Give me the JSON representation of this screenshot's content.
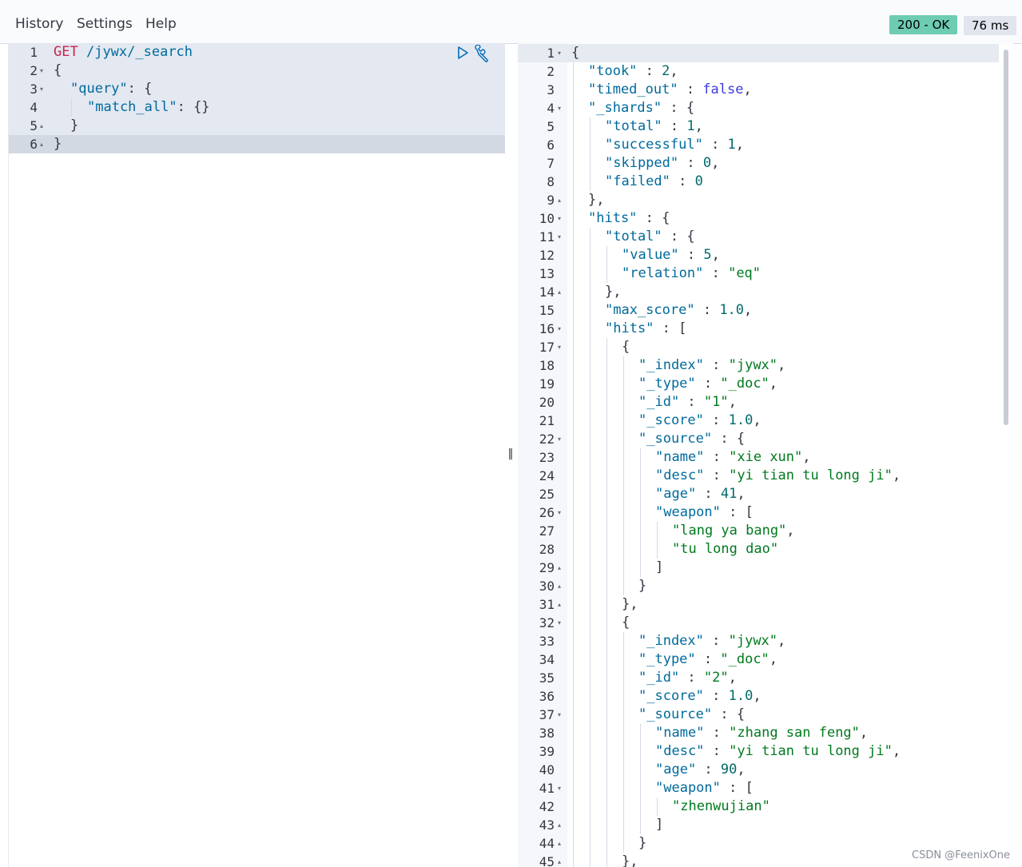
{
  "menu": {
    "history": "History",
    "settings": "Settings",
    "help": "Help"
  },
  "status": {
    "code": "200 - OK",
    "time": "76 ms"
  },
  "icons": {
    "run": "play-icon",
    "settings": "wrench-icon"
  },
  "request": {
    "lines": [
      {
        "n": "1",
        "fold": "",
        "indent": 0,
        "tokens": [
          [
            "method",
            "GET"
          ],
          [
            "punc",
            " "
          ],
          [
            "url",
            "/jywx/_search"
          ]
        ]
      },
      {
        "n": "2",
        "fold": "▾",
        "indent": 0,
        "tokens": [
          [
            "punc",
            "{"
          ]
        ]
      },
      {
        "n": "3",
        "fold": "▾",
        "indent": 1,
        "tokens": [
          [
            "key",
            "\"query\""
          ],
          [
            "punc",
            ": {"
          ]
        ]
      },
      {
        "n": "4",
        "fold": "",
        "indent": 2,
        "tokens": [
          [
            "key",
            "\"match_all\""
          ],
          [
            "punc",
            ": {}"
          ]
        ]
      },
      {
        "n": "5",
        "fold": "▴",
        "indent": 1,
        "tokens": [
          [
            "punc",
            "}"
          ]
        ]
      },
      {
        "n": "6",
        "fold": "▴",
        "indent": 0,
        "tokens": [
          [
            "punc",
            "}"
          ]
        ]
      }
    ]
  },
  "response": {
    "lines": [
      {
        "n": "1",
        "fold": "▾",
        "indent": 0,
        "tokens": [
          [
            "punc",
            "{"
          ]
        ]
      },
      {
        "n": "2",
        "fold": "",
        "indent": 1,
        "tokens": [
          [
            "key",
            "\"took\""
          ],
          [
            "punc",
            " : "
          ],
          [
            "num",
            "2"
          ],
          [
            "punc",
            ","
          ]
        ]
      },
      {
        "n": "3",
        "fold": "",
        "indent": 1,
        "tokens": [
          [
            "key",
            "\"timed_out\""
          ],
          [
            "punc",
            " : "
          ],
          [
            "bool",
            "false"
          ],
          [
            "punc",
            ","
          ]
        ]
      },
      {
        "n": "4",
        "fold": "▾",
        "indent": 1,
        "tokens": [
          [
            "key",
            "\"_shards\""
          ],
          [
            "punc",
            " : {"
          ]
        ]
      },
      {
        "n": "5",
        "fold": "",
        "indent": 2,
        "tokens": [
          [
            "key",
            "\"total\""
          ],
          [
            "punc",
            " : "
          ],
          [
            "num",
            "1"
          ],
          [
            "punc",
            ","
          ]
        ]
      },
      {
        "n": "6",
        "fold": "",
        "indent": 2,
        "tokens": [
          [
            "key",
            "\"successful\""
          ],
          [
            "punc",
            " : "
          ],
          [
            "num",
            "1"
          ],
          [
            "punc",
            ","
          ]
        ]
      },
      {
        "n": "7",
        "fold": "",
        "indent": 2,
        "tokens": [
          [
            "key",
            "\"skipped\""
          ],
          [
            "punc",
            " : "
          ],
          [
            "num",
            "0"
          ],
          [
            "punc",
            ","
          ]
        ]
      },
      {
        "n": "8",
        "fold": "",
        "indent": 2,
        "tokens": [
          [
            "key",
            "\"failed\""
          ],
          [
            "punc",
            " : "
          ],
          [
            "num",
            "0"
          ]
        ]
      },
      {
        "n": "9",
        "fold": "▴",
        "indent": 1,
        "tokens": [
          [
            "punc",
            "},"
          ]
        ]
      },
      {
        "n": "10",
        "fold": "▾",
        "indent": 1,
        "tokens": [
          [
            "key",
            "\"hits\""
          ],
          [
            "punc",
            " : {"
          ]
        ]
      },
      {
        "n": "11",
        "fold": "▾",
        "indent": 2,
        "tokens": [
          [
            "key",
            "\"total\""
          ],
          [
            "punc",
            " : {"
          ]
        ]
      },
      {
        "n": "12",
        "fold": "",
        "indent": 3,
        "tokens": [
          [
            "key",
            "\"value\""
          ],
          [
            "punc",
            " : "
          ],
          [
            "num",
            "5"
          ],
          [
            "punc",
            ","
          ]
        ]
      },
      {
        "n": "13",
        "fold": "",
        "indent": 3,
        "tokens": [
          [
            "key",
            "\"relation\""
          ],
          [
            "punc",
            " : "
          ],
          [
            "str",
            "\"eq\""
          ]
        ]
      },
      {
        "n": "14",
        "fold": "▴",
        "indent": 2,
        "tokens": [
          [
            "punc",
            "},"
          ]
        ]
      },
      {
        "n": "15",
        "fold": "",
        "indent": 2,
        "tokens": [
          [
            "key",
            "\"max_score\""
          ],
          [
            "punc",
            " : "
          ],
          [
            "num",
            "1.0"
          ],
          [
            "punc",
            ","
          ]
        ]
      },
      {
        "n": "16",
        "fold": "▾",
        "indent": 2,
        "tokens": [
          [
            "key",
            "\"hits\""
          ],
          [
            "punc",
            " : ["
          ]
        ]
      },
      {
        "n": "17",
        "fold": "▾",
        "indent": 3,
        "tokens": [
          [
            "punc",
            "{"
          ]
        ]
      },
      {
        "n": "18",
        "fold": "",
        "indent": 4,
        "tokens": [
          [
            "key",
            "\"_index\""
          ],
          [
            "punc",
            " : "
          ],
          [
            "str",
            "\"jywx\""
          ],
          [
            "punc",
            ","
          ]
        ]
      },
      {
        "n": "19",
        "fold": "",
        "indent": 4,
        "tokens": [
          [
            "key",
            "\"_type\""
          ],
          [
            "punc",
            " : "
          ],
          [
            "str",
            "\"_doc\""
          ],
          [
            "punc",
            ","
          ]
        ]
      },
      {
        "n": "20",
        "fold": "",
        "indent": 4,
        "tokens": [
          [
            "key",
            "\"_id\""
          ],
          [
            "punc",
            " : "
          ],
          [
            "str",
            "\"1\""
          ],
          [
            "punc",
            ","
          ]
        ]
      },
      {
        "n": "21",
        "fold": "",
        "indent": 4,
        "tokens": [
          [
            "key",
            "\"_score\""
          ],
          [
            "punc",
            " : "
          ],
          [
            "num",
            "1.0"
          ],
          [
            "punc",
            ","
          ]
        ]
      },
      {
        "n": "22",
        "fold": "▾",
        "indent": 4,
        "tokens": [
          [
            "key",
            "\"_source\""
          ],
          [
            "punc",
            " : {"
          ]
        ]
      },
      {
        "n": "23",
        "fold": "",
        "indent": 5,
        "tokens": [
          [
            "key",
            "\"name\""
          ],
          [
            "punc",
            " : "
          ],
          [
            "str",
            "\"xie xun\""
          ],
          [
            "punc",
            ","
          ]
        ]
      },
      {
        "n": "24",
        "fold": "",
        "indent": 5,
        "tokens": [
          [
            "key",
            "\"desc\""
          ],
          [
            "punc",
            " : "
          ],
          [
            "str",
            "\"yi tian tu long ji\""
          ],
          [
            "punc",
            ","
          ]
        ]
      },
      {
        "n": "25",
        "fold": "",
        "indent": 5,
        "tokens": [
          [
            "key",
            "\"age\""
          ],
          [
            "punc",
            " : "
          ],
          [
            "num",
            "41"
          ],
          [
            "punc",
            ","
          ]
        ]
      },
      {
        "n": "26",
        "fold": "▾",
        "indent": 5,
        "tokens": [
          [
            "key",
            "\"weapon\""
          ],
          [
            "punc",
            " : ["
          ]
        ]
      },
      {
        "n": "27",
        "fold": "",
        "indent": 6,
        "tokens": [
          [
            "str",
            "\"lang ya bang\""
          ],
          [
            "punc",
            ","
          ]
        ]
      },
      {
        "n": "28",
        "fold": "",
        "indent": 6,
        "tokens": [
          [
            "str",
            "\"tu long dao\""
          ]
        ]
      },
      {
        "n": "29",
        "fold": "▴",
        "indent": 5,
        "tokens": [
          [
            "punc",
            "]"
          ]
        ]
      },
      {
        "n": "30",
        "fold": "▴",
        "indent": 4,
        "tokens": [
          [
            "punc",
            "}"
          ]
        ]
      },
      {
        "n": "31",
        "fold": "▴",
        "indent": 3,
        "tokens": [
          [
            "punc",
            "},"
          ]
        ]
      },
      {
        "n": "32",
        "fold": "▾",
        "indent": 3,
        "tokens": [
          [
            "punc",
            "{"
          ]
        ]
      },
      {
        "n": "33",
        "fold": "",
        "indent": 4,
        "tokens": [
          [
            "key",
            "\"_index\""
          ],
          [
            "punc",
            " : "
          ],
          [
            "str",
            "\"jywx\""
          ],
          [
            "punc",
            ","
          ]
        ]
      },
      {
        "n": "34",
        "fold": "",
        "indent": 4,
        "tokens": [
          [
            "key",
            "\"_type\""
          ],
          [
            "punc",
            " : "
          ],
          [
            "str",
            "\"_doc\""
          ],
          [
            "punc",
            ","
          ]
        ]
      },
      {
        "n": "35",
        "fold": "",
        "indent": 4,
        "tokens": [
          [
            "key",
            "\"_id\""
          ],
          [
            "punc",
            " : "
          ],
          [
            "str",
            "\"2\""
          ],
          [
            "punc",
            ","
          ]
        ]
      },
      {
        "n": "36",
        "fold": "",
        "indent": 4,
        "tokens": [
          [
            "key",
            "\"_score\""
          ],
          [
            "punc",
            " : "
          ],
          [
            "num",
            "1.0"
          ],
          [
            "punc",
            ","
          ]
        ]
      },
      {
        "n": "37",
        "fold": "▾",
        "indent": 4,
        "tokens": [
          [
            "key",
            "\"_source\""
          ],
          [
            "punc",
            " : {"
          ]
        ]
      },
      {
        "n": "38",
        "fold": "",
        "indent": 5,
        "tokens": [
          [
            "key",
            "\"name\""
          ],
          [
            "punc",
            " : "
          ],
          [
            "str",
            "\"zhang san feng\""
          ],
          [
            "punc",
            ","
          ]
        ]
      },
      {
        "n": "39",
        "fold": "",
        "indent": 5,
        "tokens": [
          [
            "key",
            "\"desc\""
          ],
          [
            "punc",
            " : "
          ],
          [
            "str",
            "\"yi tian tu long ji\""
          ],
          [
            "punc",
            ","
          ]
        ]
      },
      {
        "n": "40",
        "fold": "",
        "indent": 5,
        "tokens": [
          [
            "key",
            "\"age\""
          ],
          [
            "punc",
            " : "
          ],
          [
            "num",
            "90"
          ],
          [
            "punc",
            ","
          ]
        ]
      },
      {
        "n": "41",
        "fold": "▾",
        "indent": 5,
        "tokens": [
          [
            "key",
            "\"weapon\""
          ],
          [
            "punc",
            " : ["
          ]
        ]
      },
      {
        "n": "42",
        "fold": "",
        "indent": 6,
        "tokens": [
          [
            "str",
            "\"zhenwujian\""
          ]
        ]
      },
      {
        "n": "43",
        "fold": "▴",
        "indent": 5,
        "tokens": [
          [
            "punc",
            "]"
          ]
        ]
      },
      {
        "n": "44",
        "fold": "▴",
        "indent": 4,
        "tokens": [
          [
            "punc",
            "}"
          ]
        ]
      },
      {
        "n": "45",
        "fold": "▴",
        "indent": 3,
        "tokens": [
          [
            "punc",
            "},"
          ]
        ]
      }
    ]
  },
  "divider": "‖",
  "watermark": "CSDN @FeenixOne"
}
